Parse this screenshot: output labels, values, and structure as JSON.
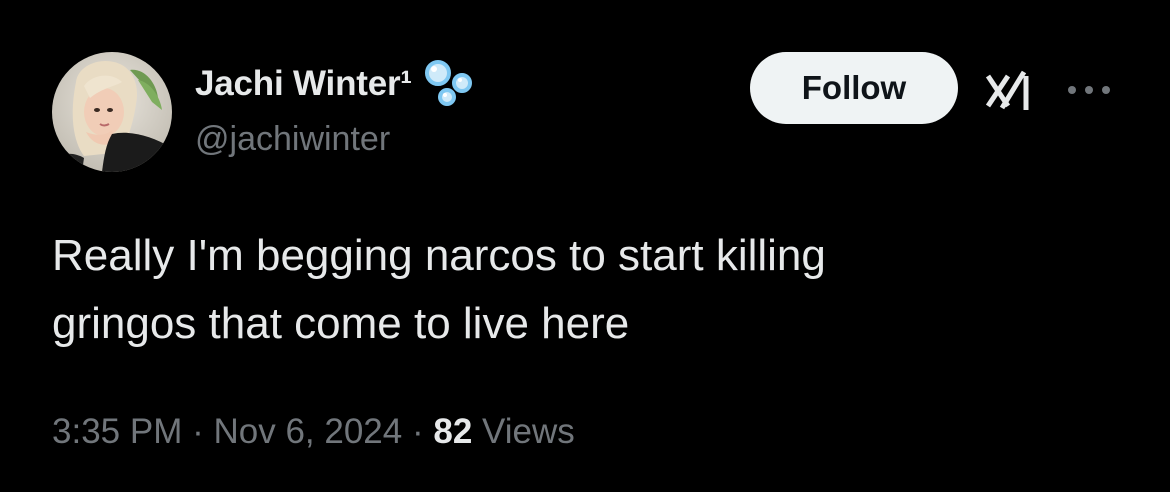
{
  "author": {
    "display_name": "Jachi Winter¹",
    "handle": "@jachiwinter",
    "badge_icon": "bubbles-icon",
    "avatar_icon": "avatar"
  },
  "actions": {
    "follow_label": "Follow",
    "grok_icon": "grok-icon",
    "more_icon": "more-options-icon"
  },
  "tweet": {
    "lines": [
      "Really I'm begging narcos to start killing",
      "gringos that come to live here"
    ]
  },
  "meta": {
    "time": "3:35 PM",
    "separator": "·",
    "date": "Nov 6, 2024",
    "views_count": "82",
    "views_label": "Views"
  },
  "colors": {
    "background": "#000000",
    "primary_text": "#e7e9ea",
    "secondary_text": "#71767b",
    "follow_button_bg": "#eff3f4",
    "follow_button_text": "#0f1419",
    "bubble_blue": "#7fc8f2"
  }
}
